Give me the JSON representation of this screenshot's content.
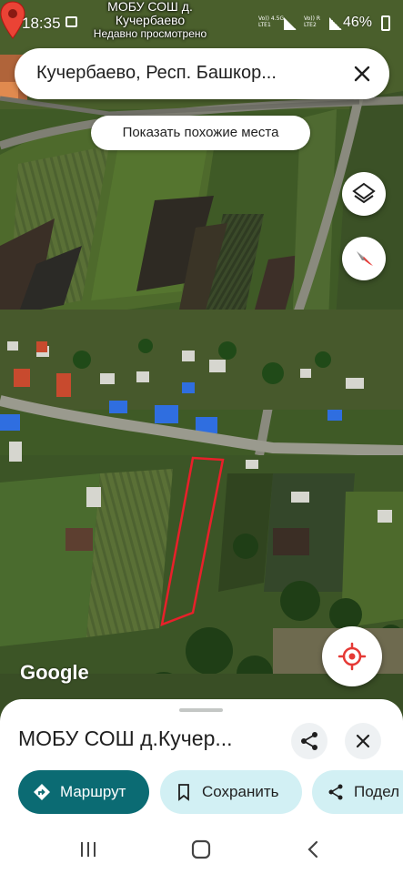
{
  "status_bar": {
    "time": "18:35",
    "battery": "46%",
    "signal_1": "Vo)) 4.5G\nLTE1",
    "signal_2": "Vo)) R\nLTE2"
  },
  "map": {
    "marker_title": "МОБУ СОШ д.",
    "marker_subtitle": "Кучербаево",
    "marker_caption": "Недавно просмотрено",
    "logo": "Google",
    "plot_outline_color": "#e8202a",
    "marker_color": "#ea4335"
  },
  "search": {
    "query": "Кучербаево, Респ. Башкор...",
    "close_icon": "close-icon"
  },
  "chips": {
    "similar_places": "Показать похожие места"
  },
  "controls": {
    "layers_icon": "layers-icon",
    "compass_icon": "compass-icon",
    "my_location_icon": "my-location-icon"
  },
  "sheet": {
    "title": "МОБУ СОШ д.Кучер...",
    "share_icon": "share-icon",
    "close_icon": "close-icon",
    "actions": {
      "route": "Маршрут",
      "save": "Сохранить",
      "share": "Подел"
    },
    "accent": "#0b6b73",
    "tonal": "#d2f0f4"
  },
  "nav": {
    "recents_icon": "recents-icon",
    "home_icon": "home-icon",
    "back_icon": "back-icon"
  }
}
